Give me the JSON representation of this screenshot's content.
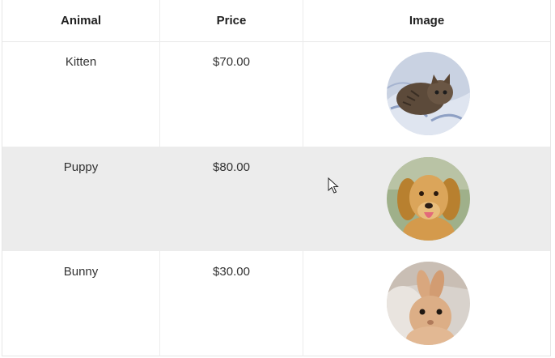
{
  "table": {
    "headers": {
      "animal": "Animal",
      "price": "Price",
      "image": "Image"
    },
    "rows": [
      {
        "animal": "Kitten",
        "price": "$70.00",
        "image_icon": "kitten-photo",
        "highlighted": false
      },
      {
        "animal": "Puppy",
        "price": "$80.00",
        "image_icon": "puppy-photo",
        "highlighted": true
      },
      {
        "animal": "Bunny",
        "price": "$30.00",
        "image_icon": "bunny-photo",
        "highlighted": false
      }
    ]
  },
  "colors": {
    "row_hover": "#ececec",
    "border": "#e6e6e6"
  }
}
